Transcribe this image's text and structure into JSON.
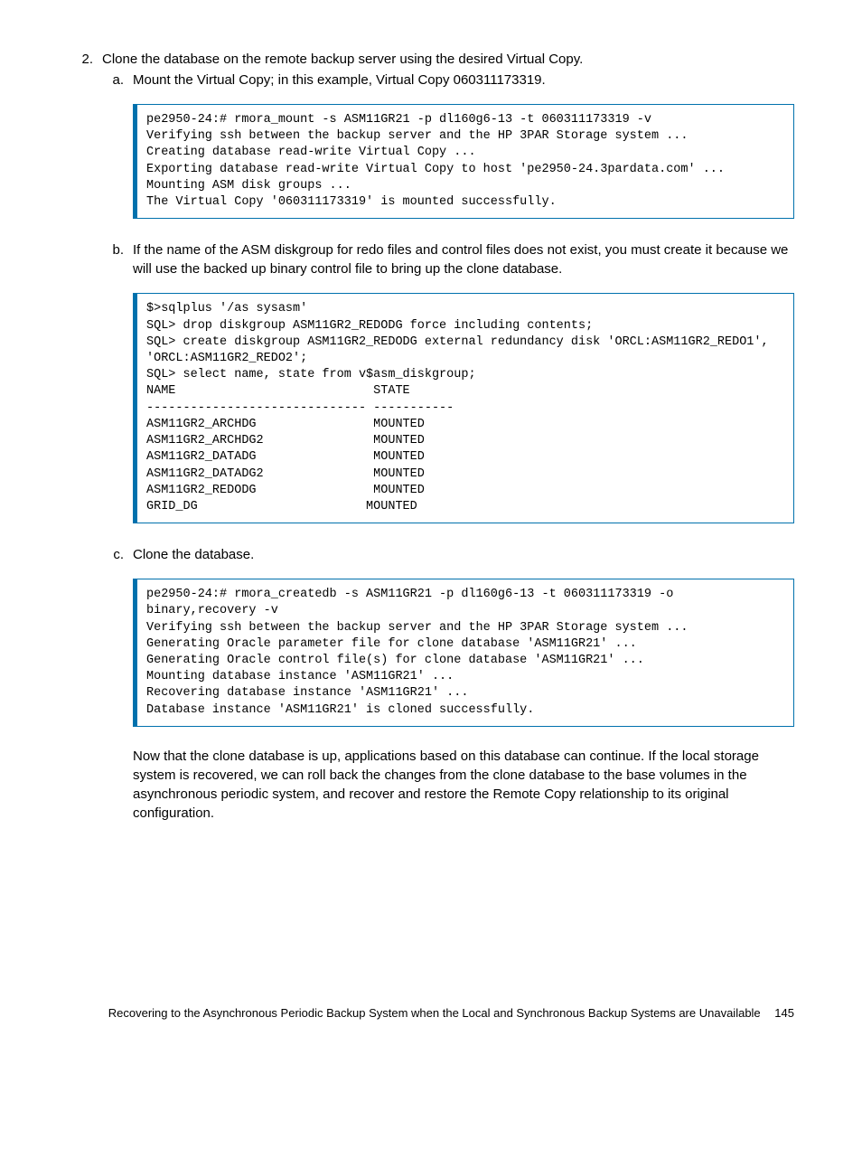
{
  "step2": {
    "number": "2.",
    "text": "Clone the database on the remote backup server using the desired Virtual Copy.",
    "a": {
      "number": "a.",
      "text": "Mount the Virtual Copy; in this example, Virtual Copy 060311173319.",
      "code": "pe2950-24:# rmora_mount -s ASM11GR21 -p dl160g6-13 -t 060311173319 -v\nVerifying ssh between the backup server and the HP 3PAR Storage system ...\nCreating database read-write Virtual Copy ...\nExporting database read-write Virtual Copy to host 'pe2950-24.3pardata.com' ...\nMounting ASM disk groups ...\nThe Virtual Copy '060311173319' is mounted successfully."
    },
    "b": {
      "number": "b.",
      "text": "If the name of the ASM diskgroup for redo files and control files does not exist, you must create it because we will use the backed up binary control file to bring up the clone database.",
      "code": "$>sqlplus '/as sysasm'\nSQL> drop diskgroup ASM11GR2_REDODG force including contents;\nSQL> create diskgroup ASM11GR2_REDODG external redundancy disk 'ORCL:ASM11GR2_REDO1', 'ORCL:ASM11GR2_REDO2';\nSQL> select name, state from v$asm_diskgroup;\nNAME                           STATE\n------------------------------ -----------\nASM11GR2_ARCHDG                MOUNTED\nASM11GR2_ARCHDG2               MOUNTED\nASM11GR2_DATADG                MOUNTED\nASM11GR2_DATADG2               MOUNTED\nASM11GR2_REDODG                MOUNTED\nGRID_DG                       MOUNTED"
    },
    "c": {
      "number": "c.",
      "text": "Clone the database.",
      "code": "pe2950-24:# rmora_createdb -s ASM11GR21 -p dl160g6-13 -t 060311173319 -o binary,recovery -v\nVerifying ssh between the backup server and the HP 3PAR Storage system ...\nGenerating Oracle parameter file for clone database 'ASM11GR21' ...\nGenerating Oracle control file(s) for clone database 'ASM11GR21' ...\nMounting database instance 'ASM11GR21' ...\nRecovering database instance 'ASM11GR21' ...\nDatabase instance 'ASM11GR21' is cloned successfully.",
      "after": "Now that the clone database is up, applications based on this database can continue. If the local storage system is recovered, we can roll back the changes from the clone database to the base volumes in the asynchronous periodic system, and recover and restore the Remote Copy relationship to its original configuration."
    }
  },
  "footer": {
    "title": "Recovering to the Asynchronous Periodic Backup System when the Local and Synchronous Backup Systems are Unavailable",
    "page": "145"
  }
}
